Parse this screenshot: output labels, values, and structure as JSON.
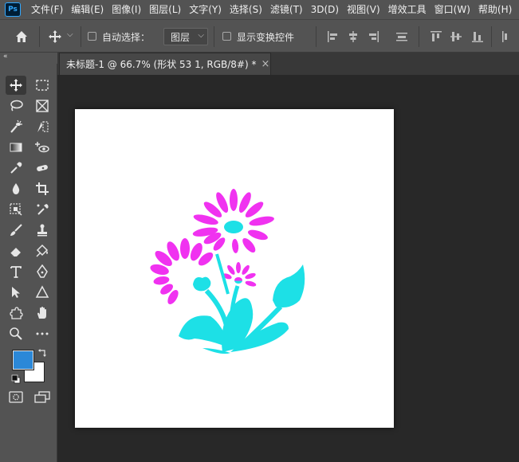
{
  "app": {
    "logo_text": "Ps"
  },
  "menu": [
    "文件(F)",
    "编辑(E)",
    "图像(I)",
    "图层(L)",
    "文字(Y)",
    "选择(S)",
    "滤镜(T)",
    "3D(D)",
    "视图(V)",
    "增效工具",
    "窗口(W)",
    "帮助(H)"
  ],
  "options": {
    "auto_select_label": "自动选择：",
    "auto_select_checked": false,
    "layer_target": "图层",
    "show_transform_label": "显示变换控件",
    "show_transform_checked": false
  },
  "panel": {
    "collapse_glyph": "«"
  },
  "document": {
    "tab_title": "未标题-1 @ 66.7% (形状 53 1, RGB/8#) *",
    "close_glyph": "×"
  },
  "colors": {
    "foreground": "#2b88d8",
    "background": "#ffffff",
    "flower_top": "#f032f0",
    "flower_mid": "#b070e0",
    "flower_bottom": "#1de0e6",
    "ui_dark": "#282828",
    "ui_panel": "#535353"
  },
  "tools": [
    "move-tool",
    "marquee-tool",
    "lasso-tool",
    "frame-tool",
    "quick-select-tool",
    "slice-tool",
    "gradient-tool",
    "eye-visibility-tool",
    "eyedropper-tool",
    "healing-tool",
    "blur-tool",
    "crop-tool",
    "object-select-tool",
    "color-sampler-tool",
    "brush-tool",
    "stamp-tool",
    "eraser-tool",
    "paint-bucket-tool",
    "type-tool",
    "pen-tool",
    "path-select-tool",
    "shape-tool",
    "custom-shape-tool",
    "hand-tool",
    "zoom-tool",
    "more-tools",
    "quick-mask",
    "screen-mode"
  ]
}
